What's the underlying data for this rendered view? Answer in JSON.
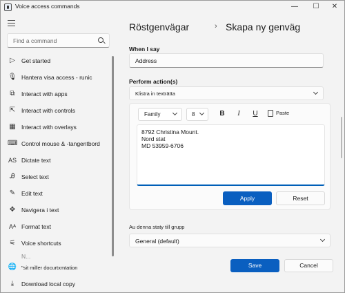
{
  "window": {
    "title": "Voice access commands",
    "controls": {
      "minimize": "—",
      "maximize": "☐",
      "close": "✕"
    }
  },
  "sidebar": {
    "search_placeholder": "Find a command",
    "items": [
      {
        "label": "Get started",
        "icon": "▷",
        "icon_name": "play-icon"
      },
      {
        "label": "Hantera visa access - runic",
        "icon": "🎙",
        "icon_name": "microphone-icon"
      },
      {
        "label": "Interact with apps",
        "icon": "⧉",
        "icon_name": "apps-icon"
      },
      {
        "label": "Interact with controls",
        "icon": "⇱",
        "icon_name": "cursor-icon"
      },
      {
        "label": "Interact with overlays",
        "icon": "▦",
        "icon_name": "grid-icon"
      },
      {
        "label": "Control mouse & -tangentbord",
        "icon": "⌨",
        "icon_name": "keyboard-icon"
      },
      {
        "label": "Dictate text",
        "icon": "AS",
        "icon_name": "dictate-icon"
      },
      {
        "label": "Select text",
        "icon": "Ꭿ",
        "icon_name": "select-text-icon"
      },
      {
        "label": "Edit text",
        "icon": "✎",
        "icon_name": "edit-text-icon"
      },
      {
        "label": "Navigera i text",
        "icon": "✥",
        "icon_name": "navigate-icon"
      },
      {
        "label": "Format text",
        "icon": "Aᴬ",
        "icon_name": "format-text-icon"
      },
      {
        "label": "Voice shortcuts",
        "icon": "⚟",
        "icon_name": "voice-shortcuts-icon"
      },
      {
        "label": "N...",
        "icon": "",
        "icon_name": "partial-icon"
      }
    ],
    "bottom": [
      {
        "label": "\"sit miller docurtxmtation",
        "icon": "🌐",
        "icon_name": "globe-icon"
      },
      {
        "label": "Download local copy",
        "icon": "⤓",
        "icon_name": "download-icon"
      }
    ]
  },
  "breadcrumb": {
    "parent": "Röstgenvägar",
    "separator": "›",
    "current": "Skapa ny genväg"
  },
  "form": {
    "when_i_say_label": "When I say",
    "when_i_say_value": "Address",
    "perform_actions_label": "Perform action(s)",
    "action_selected": "Klistra in texträtta",
    "editor": {
      "font_family": "Family",
      "font_size": "8",
      "bold": "B",
      "italic": "I",
      "underline": "U",
      "paste": "Paste",
      "lines": [
        "8792 Christina Mount.",
        "Nord stat",
        "MD 53959-6706"
      ],
      "apply": "Apply",
      "reset": "Reset"
    },
    "group_label": "Au denna staty till grupp",
    "group_value": "General (default)",
    "save": "Save",
    "cancel": "Cancel"
  },
  "colors": {
    "accent": "#0a5fc0",
    "background": "#f3f3f3"
  }
}
